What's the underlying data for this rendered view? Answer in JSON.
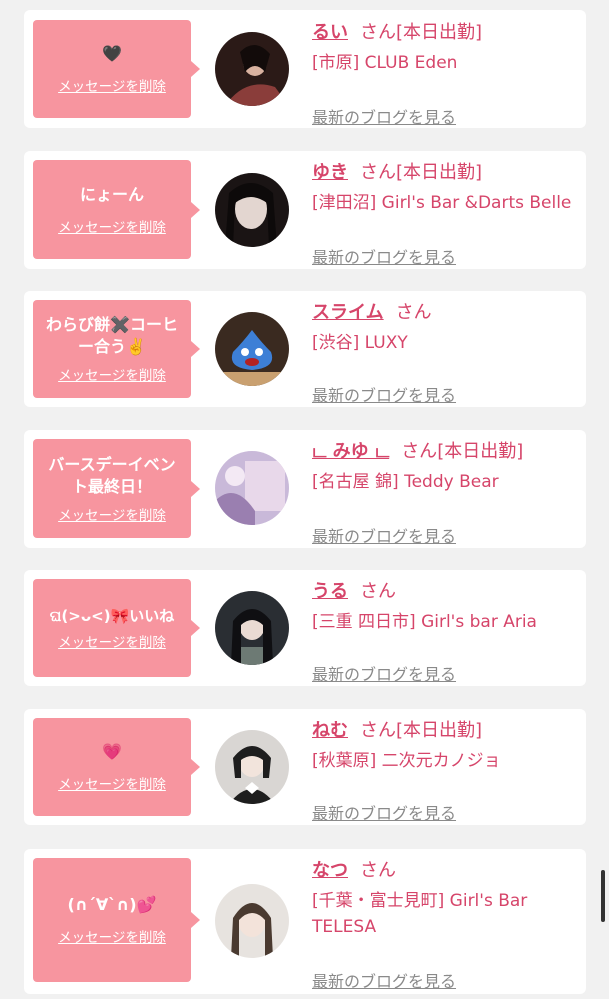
{
  "delete_label": "メッセージを削除",
  "blog_label": "最新のブログを見る",
  "san_label": "さん",
  "cards": [
    {
      "message": "🖤",
      "name": "るい",
      "status": "[本日出勤]",
      "shop": "[市原] CLUB Eden",
      "avatar_colors": [
        "#2b1a17",
        "#8a3d3a"
      ]
    },
    {
      "message": "にょーん",
      "name": "ゆき",
      "status": "[本日出勤]",
      "shop": "[津田沼] Girl's Bar &Darts Belle",
      "avatar_colors": [
        "#1a1414",
        "#5b4b48"
      ]
    },
    {
      "message": "わらび餅✖️コーヒー合う✌️",
      "name": "スライム",
      "status": "",
      "shop": "[渋谷] LUXY",
      "avatar_colors": [
        "#3a2a20",
        "#3d7fd6"
      ]
    },
    {
      "message": "バースデーイベント最終日！",
      "name": "ட みゆ ட",
      "status": "[本日出勤]",
      "shop": "[名古屋 錦] Teddy Bear",
      "avatar_colors": [
        "#c9b9d9",
        "#e8d8ea"
      ]
    },
    {
      "message": "ଘ(>ᴗ<)🎀いいね",
      "name": "うる",
      "status": "",
      "shop": "[三重 四日市] Girl's bar Aria",
      "avatar_colors": [
        "#2a2e33",
        "#6d7a74"
      ]
    },
    {
      "message": "💗",
      "name": "ねむ",
      "status": "[本日出勤]",
      "shop": "[秋葉原] 二次元カノジョ",
      "avatar_colors": [
        "#d9d6d3",
        "#1e1e1e"
      ]
    },
    {
      "message": "(∩´∀`∩)💕",
      "name": "なつ",
      "status": "",
      "shop": "[千葉・富士見町] Girl's Bar TELESA",
      "avatar_colors": [
        "#e7e3df",
        "#4a3a30"
      ]
    }
  ]
}
